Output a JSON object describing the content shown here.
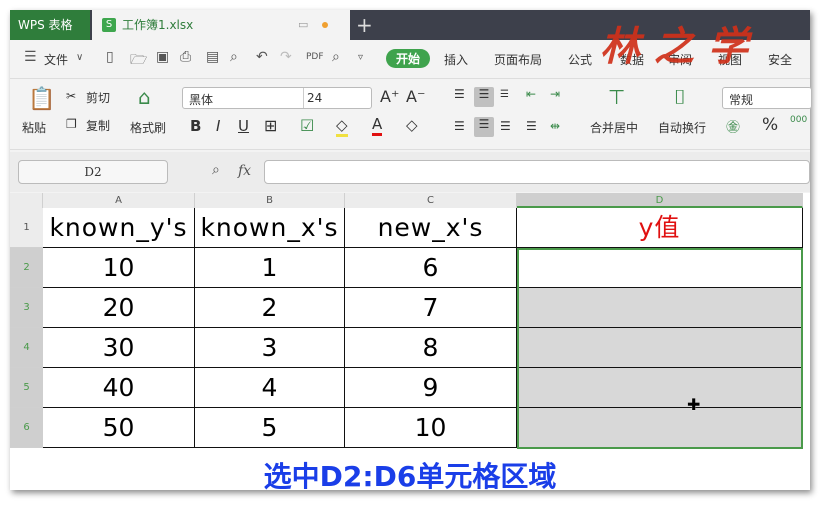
{
  "tabs": {
    "app": "WPS 表格",
    "doc": "工作簿1.xlsx",
    "new": "+"
  },
  "logo_text": "林之学",
  "menu": {
    "file": "文件",
    "items": [
      "开始",
      "插入",
      "页面布局",
      "公式",
      "数据",
      "审阅",
      "视图",
      "安全"
    ]
  },
  "ribbon": {
    "paste": "粘贴",
    "cut": "剪切",
    "copy": "复制",
    "format_painter": "格式刷",
    "font": "黑体",
    "size": "24",
    "merge": "合并居中",
    "wrap": "自动换行",
    "number_format": "常规",
    "percent": "%"
  },
  "formula": {
    "name_box": "D2",
    "fx": "fx",
    "value": ""
  },
  "columns": [
    "A",
    "B",
    "C",
    "D"
  ],
  "rows": [
    "1",
    "2",
    "3",
    "4",
    "5",
    "6"
  ],
  "table": [
    [
      "known_y's",
      "known_x's",
      "new_x's",
      "y值"
    ],
    [
      "10",
      "1",
      "6",
      ""
    ],
    [
      "20",
      "2",
      "7",
      ""
    ],
    [
      "30",
      "3",
      "8",
      ""
    ],
    [
      "40",
      "4",
      "9",
      ""
    ],
    [
      "50",
      "5",
      "10",
      ""
    ]
  ],
  "caption": "选中D2:D6单元格区域",
  "colors": {
    "accent": "#2f7d3b",
    "selection": "#4a9a4a",
    "caption": "#1a3ee8",
    "header_red": "#e01010"
  }
}
